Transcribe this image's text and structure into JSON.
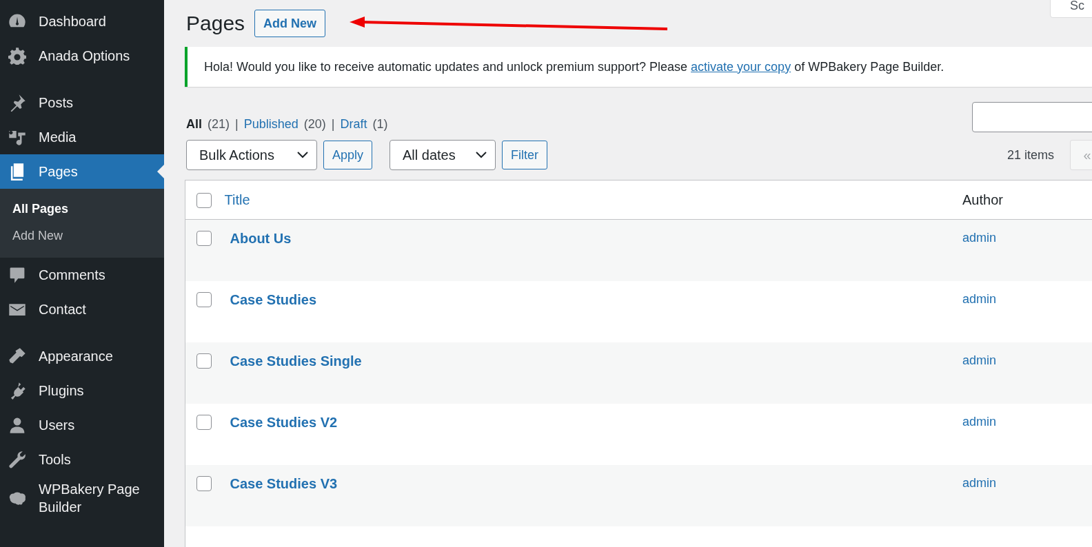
{
  "sidebar": {
    "groups": [
      {
        "items": [
          {
            "label": "Dashboard",
            "selected": false
          },
          {
            "label": "Anada Options",
            "selected": false
          }
        ]
      },
      {
        "items": [
          {
            "label": "Posts",
            "selected": false
          },
          {
            "label": "Media",
            "selected": false
          },
          {
            "label": "Pages",
            "selected": true,
            "children": [
              {
                "label": "All Pages",
                "selected": true
              },
              {
                "label": "Add New",
                "selected": false
              }
            ]
          },
          {
            "label": "Comments",
            "selected": false
          },
          {
            "label": "Contact",
            "selected": false
          }
        ]
      },
      {
        "items": [
          {
            "label": "Appearance",
            "selected": false
          },
          {
            "label": "Plugins",
            "selected": false
          },
          {
            "label": "Users",
            "selected": false
          },
          {
            "label": "Tools",
            "selected": false
          },
          {
            "label": "WPBakery Page Builder",
            "selected": false
          }
        ]
      }
    ]
  },
  "screen_options": {
    "label": "Sc"
  },
  "header": {
    "title": "Pages",
    "add_button": "Add New"
  },
  "notice": {
    "text": "Hola! Would you like to receive automatic updates and unlock premium support? Please ",
    "link": "activate your copy",
    "text_after": " of WPBakery Page Builder."
  },
  "filters": [
    {
      "label": "All",
      "count": "(21)",
      "selected": true
    },
    {
      "label": "Published",
      "count": "(20)",
      "selected": false
    },
    {
      "label": "Draft",
      "count": "(1)",
      "selected": false
    }
  ],
  "filter_separator": "|",
  "bulk_actions": {
    "value": "Bulk Actions",
    "button": "Apply"
  },
  "date_filter": {
    "value": "All dates",
    "button": "Filter"
  },
  "item_count": "21 items",
  "pagination": {
    "first": "«"
  },
  "table": {
    "select_all_checked": false,
    "columns": [
      "Title",
      "Author"
    ],
    "rows": [
      {
        "title": "About Us",
        "author": "admin",
        "checked": false
      },
      {
        "title": "Case Studies",
        "author": "admin",
        "checked": false
      },
      {
        "title": "Case Studies Single",
        "author": "admin",
        "checked": false
      },
      {
        "title": "Case Studies V2",
        "author": "admin",
        "checked": false
      },
      {
        "title": "Case Studies V3",
        "author": "admin",
        "checked": false
      }
    ]
  }
}
